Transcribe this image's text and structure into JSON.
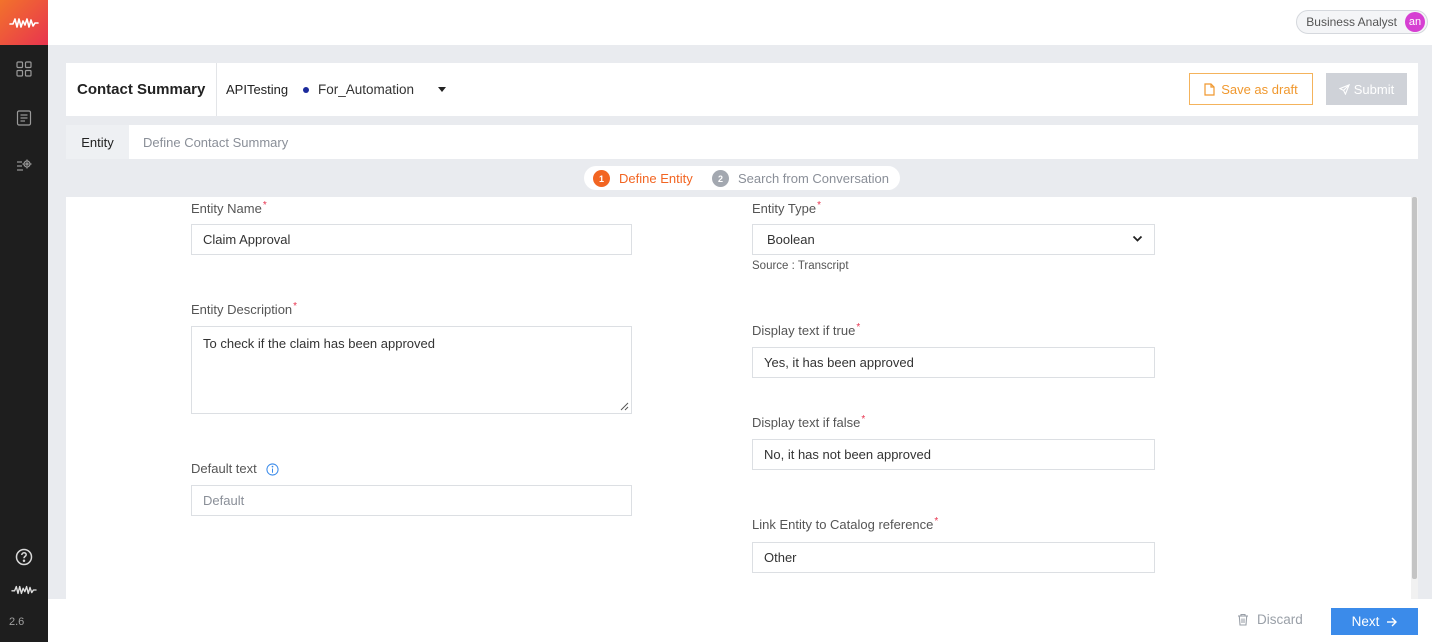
{
  "user": {
    "role": "Business Analyst",
    "initials": "an"
  },
  "app": {
    "version": "2.6"
  },
  "header": {
    "title": "Contact Summary",
    "project": "APITesting",
    "variant": "For_Automation",
    "save_draft_label": "Save as draft",
    "submit_label": "Submit"
  },
  "tabs": {
    "active": "Entity",
    "inactive": "Define Contact Summary"
  },
  "stepper": {
    "steps": [
      {
        "num": "1",
        "label": "Define Entity"
      },
      {
        "num": "2",
        "label": "Search from Conversation"
      }
    ]
  },
  "form": {
    "entity_name": {
      "label": "Entity Name",
      "value": "Claim Approval"
    },
    "entity_description": {
      "label": "Entity Description",
      "value": "To check if the claim has been approved"
    },
    "default_text": {
      "label": "Default text",
      "placeholder": "Default"
    },
    "entity_type": {
      "label": "Entity Type",
      "value": "Boolean",
      "source": "Source : Transcript"
    },
    "display_true": {
      "label": "Display text if true",
      "value": "Yes, it has been approved"
    },
    "display_false": {
      "label": "Display text if false",
      "value": "No, it has not been approved"
    },
    "catalog_ref": {
      "label": "Link Entity to Catalog reference",
      "value": "Other"
    },
    "required_mark": "*"
  },
  "footer": {
    "discard_label": "Discard",
    "next_label": "Next"
  },
  "colors": {
    "accent_orange": "#f0982e",
    "step_active": "#f26522",
    "primary_blue": "#3b8bea",
    "required_red": "#e8344f"
  }
}
